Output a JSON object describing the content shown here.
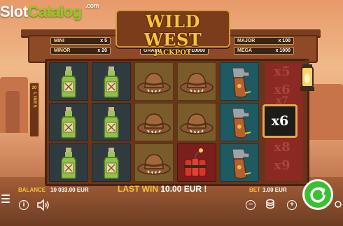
{
  "watermark": {
    "brand_a": "Slot",
    "brand_b": "Catalog",
    "suffix": ".com"
  },
  "title": {
    "main": "WILD WEST",
    "sub": "JACKPOT"
  },
  "jackpots": {
    "mini": {
      "label": "MINI",
      "value": "x 5"
    },
    "minor": {
      "label": "MINOR",
      "value": "x 20"
    },
    "grand": {
      "label": "GRAND",
      "value": "x 10000"
    },
    "major": {
      "label": "MAJOR",
      "value": "x 100"
    },
    "mega": {
      "label": "MEGA",
      "value": "x 1000"
    }
  },
  "lines": {
    "count": "20",
    "label": "LINES"
  },
  "reels": [
    [
      "bottle",
      "bottle",
      "hat",
      "hat",
      "holster"
    ],
    [
      "bottle",
      "bottle",
      "hat",
      "hat",
      "holster"
    ],
    [
      "bottle",
      "bottle",
      "hat",
      "dynamite",
      "holster"
    ]
  ],
  "multipliers": {
    "ghost_top": [
      "x5",
      "x6",
      "x7"
    ],
    "active": "x6",
    "ghost_bottom": [
      "x8",
      "x9"
    ]
  },
  "bottom": {
    "balance_label": "BALANCE",
    "balance_value": "10 033.00 EUR",
    "lastwin_label": "LAST WIN",
    "lastwin_value": "10.00 EUR !",
    "bet_label": "BET",
    "bet_value": "1.00 EUR"
  },
  "icons": {
    "info": "info-icon",
    "sound": "speaker-icon",
    "minus": "minus-icon",
    "coins": "coin-stack-icon",
    "plus": "plus-icon",
    "autoplay": "autoplay-icon",
    "spin": "spin-icon",
    "menu": "menu-icon"
  },
  "colors": {
    "accent_gold": "#f6c33d",
    "spin_green": "#3cbf35",
    "wood": "#7b3c1c"
  }
}
